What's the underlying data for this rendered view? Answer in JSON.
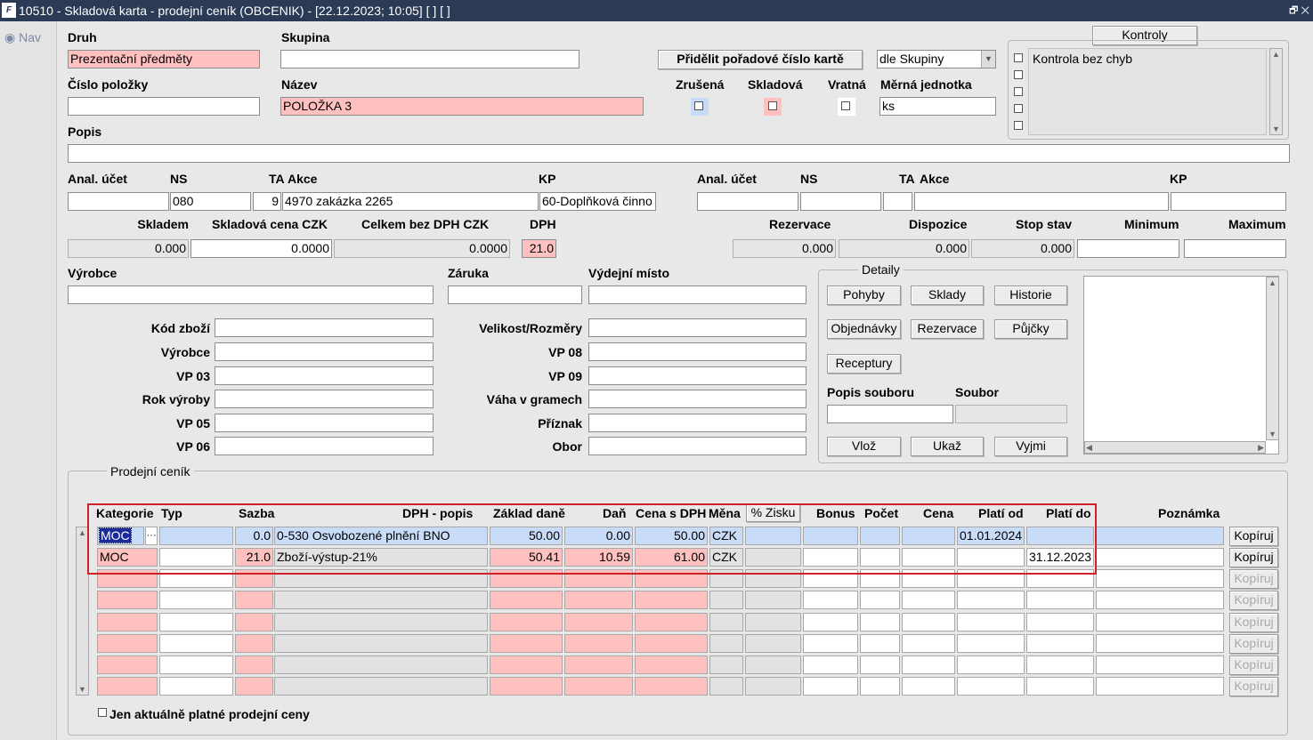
{
  "window": {
    "title": "10510 - Skladová karta - prodejní ceník (OBCENIK) - [22.12.2023; 10:05]  [ ]  [ ]",
    "logo_text": "F",
    "controls": "🗗 ✕"
  },
  "nav": {
    "label": "Nav"
  },
  "header": {
    "druh_label": "Druh",
    "druh_value": "Prezentační předměty",
    "skupina_label": "Skupina",
    "skupina_value": "",
    "cislo_label": "Číslo položky",
    "cislo_value": "",
    "nazev_label": "Název",
    "nazev_value": "POLOŽKA 3",
    "assign_button": "Přidělit pořadové číslo kartě",
    "assign_mode": "dle Skupiny",
    "zrusena_label": "Zrušená",
    "skladova_label": "Skladová",
    "vratna_label": "Vratná",
    "merna_label": "Měrná jednotka",
    "merna_value": "ks",
    "popis_label": "Popis",
    "popis_value": ""
  },
  "kontroly": {
    "button": "Kontroly",
    "items": [
      "Kontrola bez chyb",
      "",
      "",
      "",
      ""
    ]
  },
  "accounts": {
    "left": {
      "anal_label": "Anal. účet",
      "ns_label": "NS",
      "ta_label": "TA",
      "akce_label": "Akce",
      "kp_label": "KP",
      "anal": "",
      "ns": "080",
      "ta": "9",
      "akce": "4970 zakázka 2265",
      "kp": "60-Doplňková činno"
    },
    "right": {
      "anal_label": "Anal. účet",
      "ns_label": "NS",
      "ta_label": "TA",
      "akce_label": "Akce",
      "kp_label": "KP",
      "anal": "",
      "ns": "",
      "ta": "",
      "akce": "",
      "kp": ""
    }
  },
  "stock": {
    "skladem_label": "Skladem",
    "skladem": "0.000",
    "cena_label": "Skladová cena CZK",
    "cena": "0.0000",
    "celkem_label": "Celkem bez DPH  CZK",
    "celkem": "0.0000",
    "dph_label": "DPH",
    "dph": "21.0",
    "rezervace_label": "Rezervace",
    "rezervace": "0.000",
    "dispozice_label": "Dispozice",
    "dispozice": "0.000",
    "stop_label": "Stop stav",
    "stop": "0.000",
    "min_label": "Minimum",
    "min": "",
    "max_label": "Maximum",
    "max": ""
  },
  "info": {
    "vyrobce_label": "Výrobce",
    "zaruka_label": "Záruka",
    "vydejni_label": "Výdejní místo",
    "kod_label": "Kód zboží",
    "vyrobce2_label": "Výrobce",
    "vp03_label": "VP 03",
    "rok_label": "Rok výroby",
    "vp05_label": "VP 05",
    "vp06_label": "VP 06",
    "velikost_label": "Velikost/Rozměry",
    "vp08_label": "VP 08",
    "vp09_label": "VP 09",
    "vaha_label": "Váha v gramech",
    "priznak_label": "Příznak",
    "obor_label": "Obor"
  },
  "detaily": {
    "title": "Detaily",
    "buttons": [
      "Pohyby",
      "Sklady",
      "Historie",
      "Objednávky",
      "Rezervace",
      "Půjčky",
      "Receptury"
    ],
    "popis_souboru_label": "Popis souboru",
    "soubor_label": "Soubor",
    "file_buttons": [
      "Vlož",
      "Ukaž",
      "Vyjmi"
    ]
  },
  "cenik": {
    "title": "Prodejní ceník",
    "headers": {
      "kategorie": "Kategorie",
      "typ": "Typ",
      "sazba": "Sazba",
      "dph": "DPH - popis",
      "zaklad": "Základ daně",
      "dan": "Daň",
      "cena_dph": "Cena s DPH",
      "mena": "Měna",
      "zisk": "% Zisku",
      "bonus": "Bonus",
      "pocet": "Počet",
      "cena": "Cena",
      "od": "Platí od",
      "do": "Platí do",
      "poznamka": "Poznámka"
    },
    "rows": [
      {
        "kat": "MOC",
        "typ": "",
        "sazba": "0.0",
        "dph": "0-530 Osvobozené plnění BNO",
        "zaklad": "50.00",
        "dan": "0.00",
        "cena_dph": "50.00",
        "mena": "CZK",
        "zisk": "",
        "bonus": "",
        "pocet": "",
        "cena": "",
        "od": "01.01.2024",
        "do": "",
        "poznamka": "",
        "copy": "Kopíruj"
      },
      {
        "kat": "MOC",
        "typ": "",
        "sazba": "21.0",
        "dph": "Zboží-výstup-21%",
        "zaklad": "50.41",
        "dan": "10.59",
        "cena_dph": "61.00",
        "mena": "CZK",
        "zisk": "",
        "bonus": "",
        "pocet": "",
        "cena": "",
        "od": "",
        "do": "31.12.2023",
        "poznamka": "",
        "copy": "Kopíruj"
      }
    ],
    "empty_copy": "Kopíruj",
    "filter_label": "Jen aktuálně platné prodejní ceny"
  }
}
